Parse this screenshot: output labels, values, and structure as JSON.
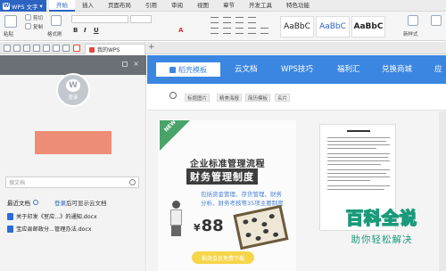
{
  "app": {
    "title": "WPS 文字",
    "logo": "W"
  },
  "menu": {
    "items": [
      "开始",
      "插入",
      "页面布局",
      "引用",
      "审阅",
      "视图",
      "章节",
      "开发工具",
      "特色功能"
    ],
    "active_index": 0
  },
  "toolbar": {
    "paste_label": "粘贴",
    "cut_label": "剪切",
    "copy_label": "复制",
    "format_painter_label": "格式刷",
    "bold": "B",
    "italic": "I",
    "underline": "U",
    "font_color": "A",
    "style_preview": "AaBbC",
    "new_style_label": "新样式"
  },
  "tabbar": {
    "doc_tab_label": "我的WPS",
    "add_label": "+"
  },
  "left_panel": {
    "avatar_letter": "W",
    "login_label": "登录",
    "accent_color": "#ee8d75",
    "search_placeholder": "搜文档",
    "recent": {
      "title": "最近文档",
      "login_link": "登录",
      "login_suffix": "后可显示云文档",
      "items": [
        {
          "name": "关于印发《室应...》的通知.docx"
        },
        {
          "name": "宝应县邮政分...管理办法.docx"
        }
      ]
    }
  },
  "right_panel": {
    "nav": {
      "first": "稻壳模板",
      "items": [
        "云文档",
        "WPS技巧",
        "福利汇",
        "兑换商城",
        "应"
      ]
    },
    "filter_tags": [
      "标题图片",
      "精美海报",
      "简历模板",
      "名片"
    ],
    "card": {
      "badge": "NEW",
      "headline1": "企业标准管理流程",
      "headline2": "财务管理制度",
      "desc": "包括资金管理、存货管理、财务分析、财务考核等35项主要制度",
      "price_symbol": "¥",
      "price": "88",
      "cta": "稻壳会员免费下载"
    }
  },
  "watermark": {
    "line1": "百科全说",
    "line2": "助你轻松解决",
    "color": "#1a9a7a"
  },
  "colors": {
    "brand_blue": "#2b63c1",
    "nav_blue": "#3b86e0",
    "yellow": "#f6d54b"
  }
}
